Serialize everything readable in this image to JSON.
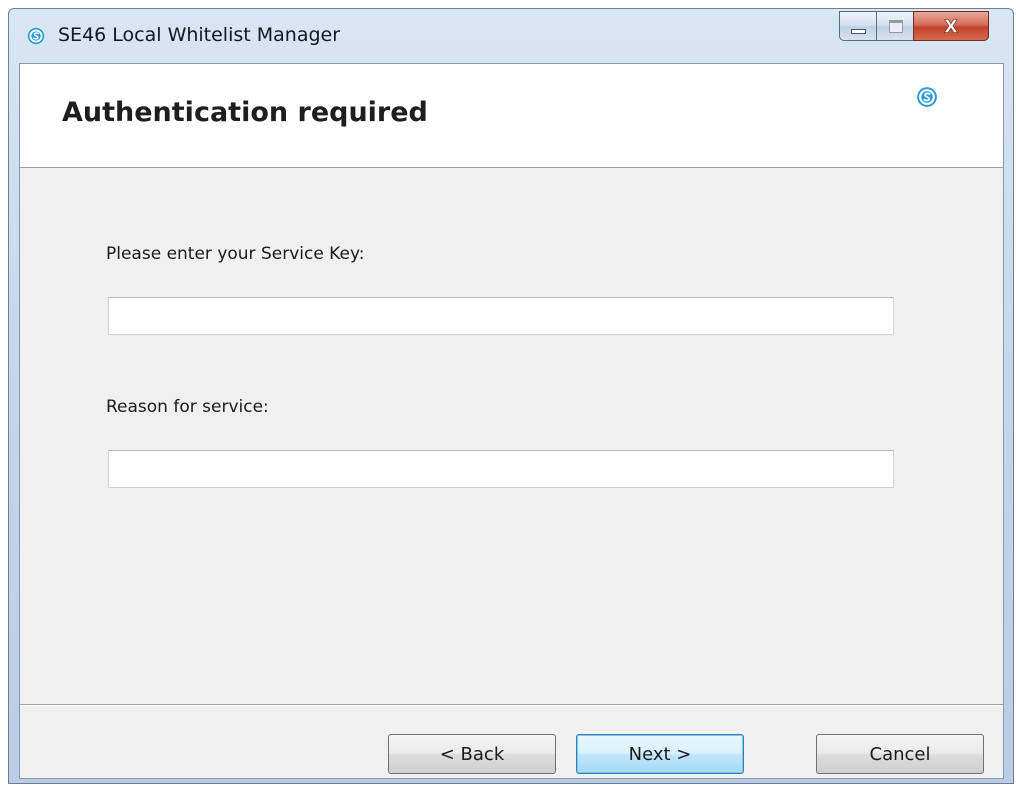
{
  "window": {
    "title": "SE46 Local Whitelist Manager",
    "app_icon": "s-circle-logo-icon",
    "caption_buttons": [
      "minimize-icon",
      "maximize-icon",
      "close-icon"
    ],
    "close_glyph": "X"
  },
  "header": {
    "title": "Authentication required",
    "logo_icon": "s-circle-logo-icon"
  },
  "form": {
    "service_key_label": "Please enter your Service Key:",
    "service_key_value": "",
    "reason_label": "Reason for service:",
    "reason_value": ""
  },
  "buttons": {
    "back_label": "< Back",
    "next_label": "Next >",
    "cancel_label": "Cancel"
  },
  "colors": {
    "accent": "#2a9ad6",
    "titlebar": "#c5d7ec",
    "close_button": "#c0432a",
    "default_button_border": "#3c7fb1"
  }
}
